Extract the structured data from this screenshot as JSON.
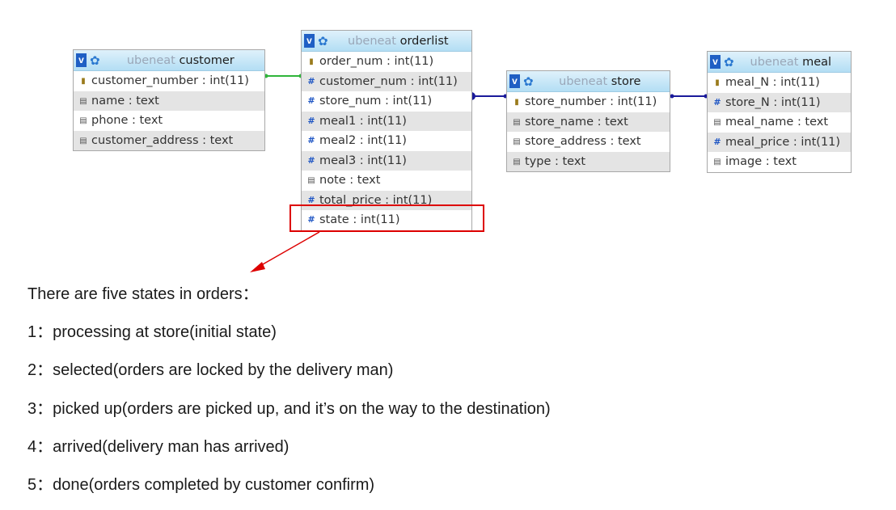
{
  "diagram": {
    "tables": [
      {
        "id": "customer",
        "db": "ubeneat",
        "name": "customer",
        "columns": [
          {
            "icon": "key",
            "text": "customer_number : int(11)"
          },
          {
            "icon": "text",
            "text": "name : text"
          },
          {
            "icon": "text",
            "text": "phone : text"
          },
          {
            "icon": "text",
            "text": "customer_address : text"
          }
        ]
      },
      {
        "id": "orderlist",
        "db": "ubeneat",
        "name": "orderlist",
        "columns": [
          {
            "icon": "key",
            "text": "order_num : int(11)"
          },
          {
            "icon": "hash",
            "text": "customer_num : int(11)"
          },
          {
            "icon": "hash",
            "text": "store_num : int(11)"
          },
          {
            "icon": "hash",
            "text": "meal1 : int(11)"
          },
          {
            "icon": "hash",
            "text": "meal2 : int(11)"
          },
          {
            "icon": "hash",
            "text": "meal3 : int(11)"
          },
          {
            "icon": "text",
            "text": "note : text"
          },
          {
            "icon": "hash",
            "text": "total_price : int(11)"
          },
          {
            "icon": "hash",
            "text": "state : int(11)"
          }
        ]
      },
      {
        "id": "store",
        "db": "ubeneat",
        "name": "store",
        "columns": [
          {
            "icon": "key",
            "text": "store_number : int(11)"
          },
          {
            "icon": "text",
            "text": "store_name : text"
          },
          {
            "icon": "text",
            "text": "store_address : text"
          },
          {
            "icon": "text",
            "text": "type : text"
          }
        ]
      },
      {
        "id": "meal",
        "db": "ubeneat",
        "name": "meal",
        "columns": [
          {
            "icon": "key",
            "text": "meal_N : int(11)"
          },
          {
            "icon": "hash",
            "text": "store_N : int(11)"
          },
          {
            "icon": "text",
            "text": "meal_name : text"
          },
          {
            "icon": "hash",
            "text": "meal_price : int(11)"
          },
          {
            "icon": "text",
            "text": "image : text"
          }
        ]
      }
    ],
    "relations": [
      {
        "from": "customer.customer_number",
        "to": "orderlist.customer_num",
        "color": "#2fb53a"
      },
      {
        "from": "store.store_number",
        "to": "orderlist.store_num",
        "color": "#1a1a9a"
      },
      {
        "from": "store.store_number",
        "to": "meal.store_N",
        "color": "#1a1a9a"
      }
    ],
    "highlight": {
      "column": "orderlist.state",
      "color": "#dd0000"
    }
  },
  "notes": {
    "intro": "There are five states in orders：",
    "states": [
      "1：processing at store(initial state)",
      "2：selected(orders are locked by the delivery man)",
      "3：picked up(orders are picked up, and it’s on the way to the destination)",
      "4：arrived(delivery man has arrived)",
      "5：done(orders completed by customer confirm)"
    ]
  },
  "icons": {
    "table_header_left": "view-v-icon",
    "table_header_gear": "gear-icon",
    "key": "key-icon",
    "hash": "hash-icon",
    "text": "text-field-icon"
  },
  "colors": {
    "header_gradient_top": "#dff1fb",
    "header_gradient_bottom": "#b3def4",
    "alt_row": "#e4e4e4",
    "db_name": "#9aa7b8"
  }
}
